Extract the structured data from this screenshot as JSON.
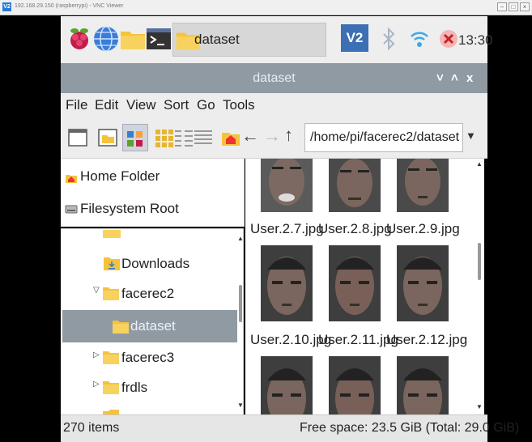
{
  "vnc": {
    "icon_text": "V2",
    "title": "192.168.29.150 (raspberrypi) - VNC Viewer"
  },
  "taskbar": {
    "window_label": "dataset",
    "tray_badge": "V2",
    "clock": "13:30"
  },
  "window": {
    "title": "dataset",
    "menus": [
      "File",
      "Edit",
      "View",
      "Sort",
      "Go",
      "Tools"
    ],
    "path": "/home/pi/facerec2/dataset"
  },
  "places": {
    "home": "Home Folder",
    "filesystem": "Filesystem Root"
  },
  "tree": {
    "downloads": "Downloads",
    "facerec2": "facerec2",
    "dataset": "dataset",
    "facerec3": "facerec3",
    "frdls": "frdls"
  },
  "files": [
    {
      "name": "User.2.7.jpg"
    },
    {
      "name": "User.2.8.jpg"
    },
    {
      "name": "User.2.9.jpg"
    },
    {
      "name": "User.2.10.jpg"
    },
    {
      "name": "User.2.11.jpg"
    },
    {
      "name": "User.2.12.jpg"
    }
  ],
  "status": {
    "items": "270 items",
    "free_space": "Free space: 23.5 GiB (Total: 29.0 GiB)"
  },
  "colors": {
    "titlebar": "#8f9aa3",
    "selection": "#8f9aa3",
    "vnc_blue": "#3c6fb4",
    "folder": "#f5c33b"
  }
}
